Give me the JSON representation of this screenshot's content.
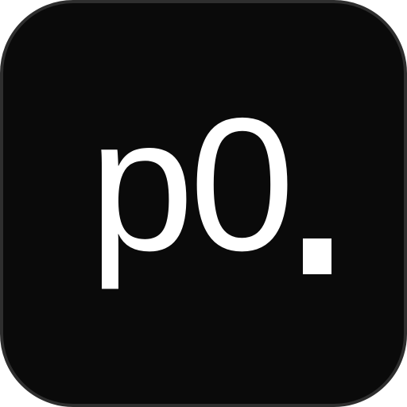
{
  "icon": {
    "text": "p0",
    "text_color": "#ffffff",
    "background_color": "#0a0a0a",
    "border_color": "#2e2e2e"
  }
}
